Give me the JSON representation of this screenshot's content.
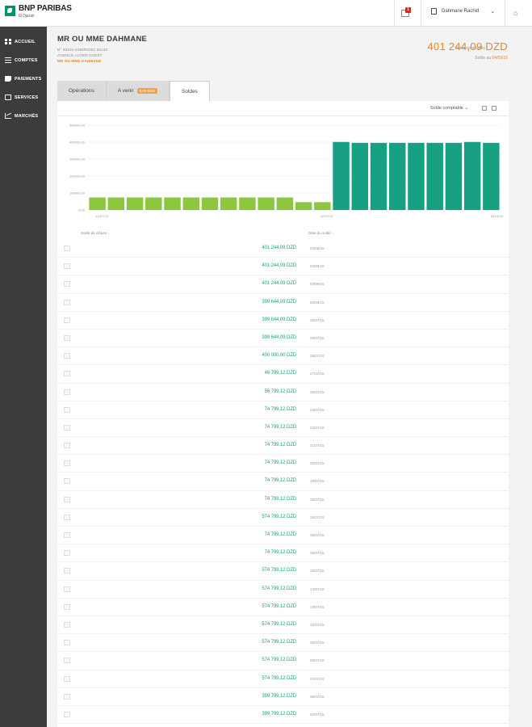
{
  "brand": {
    "name": "BNP PARIBAS",
    "sub": "El Djazaïr"
  },
  "topbar": {
    "notif_count": "1",
    "user_name": "Dahmane Rachid"
  },
  "nav": [
    {
      "label": "ACCUEIL",
      "icon": "grid-icon"
    },
    {
      "label": "COMPTES",
      "icon": "list-icon"
    },
    {
      "label": "PAIEMENTS",
      "icon": "payment-icon"
    },
    {
      "label": "SERVICES",
      "icon": "services-icon"
    },
    {
      "label": "MARCHÉS",
      "icon": "chart-icon"
    }
  ],
  "account": {
    "title": "MR OU MME DAHMANE",
    "line1": "N° 00101-0166R0002 20130",
    "line2": "AGENCE ALGER OUEST",
    "line3": "MR OU MME DAHMANE",
    "balance_label": "Solde comptable",
    "balance_value": "401 244,09 DZD",
    "balance2_label": "Solde au",
    "balance2_value": "04/09/15"
  },
  "tabs": [
    {
      "label": "Opérations",
      "badge": ""
    },
    {
      "label": "A venir",
      "badge": "0,00 DZD"
    },
    {
      "label": "Soldes",
      "badge": ""
    }
  ],
  "toolbar": {
    "select_label": "Solde comptable"
  },
  "chart_data": {
    "type": "bar",
    "yticks": [
      "500000,00",
      "400000,00",
      "300000,00",
      "200000,00",
      "100000,00",
      "0,00"
    ],
    "ylim": [
      0,
      500000
    ],
    "xticks": [
      "14/07/15",
      "20/07/15",
      "04/09/15"
    ],
    "values": [
      74000,
      74000,
      74000,
      74000,
      74000,
      74000,
      74000,
      74000,
      74000,
      74000,
      74000,
      46000,
      46000,
      401244,
      396000,
      396000,
      396000,
      396000,
      396000,
      396000,
      401244,
      396000
    ],
    "colors": {
      "low": "#8dc63f",
      "high": "#17a081"
    },
    "threshold": 200000
  },
  "table": {
    "col_amount": "Solde de clôture ↓",
    "col_date": "Date du solde ↓",
    "rows": [
      {
        "amount": "401 244,09 DZD",
        "date": "04/08/15"
      },
      {
        "amount": "401 244,09 DZD",
        "date": "04/08/15"
      },
      {
        "amount": "401 244,09 DZD",
        "date": "03/08/15"
      },
      {
        "amount": "399 644,09 DZD",
        "date": "02/08/15"
      },
      {
        "amount": "399 644,09 DZD",
        "date": "30/07/15"
      },
      {
        "amount": "399 644,09 DZD",
        "date": "29/07/15"
      },
      {
        "amount": "400 000,00 DZD",
        "date": "28/07/15"
      },
      {
        "amount": "46 799,12 DZD",
        "date": "27/07/15"
      },
      {
        "amount": "56 799,12 DZD",
        "date": "26/07/15"
      },
      {
        "amount": "74 799,12 DZD",
        "date": "23/07/15"
      },
      {
        "amount": "74 799,12 DZD",
        "date": "22/07/15"
      },
      {
        "amount": "74 799,12 DZD",
        "date": "21/07/15"
      },
      {
        "amount": "74 799,12 DZD",
        "date": "20/07/15"
      },
      {
        "amount": "74 799,12 DZD",
        "date": "19/07/15"
      },
      {
        "amount": "74 799,12 DZD",
        "date": "16/07/15"
      },
      {
        "amount": "574 799,12 DZD",
        "date": "15/07/15"
      },
      {
        "amount": "74 799,12 DZD",
        "date": "15/07/15"
      },
      {
        "amount": "74 799,12 DZD",
        "date": "16/07/15"
      },
      {
        "amount": "574 799,12 DZD",
        "date": "15/07/15"
      },
      {
        "amount": "574 799,12 DZD",
        "date": "14/07/15"
      },
      {
        "amount": "574 799,12 DZD",
        "date": "13/07/15"
      },
      {
        "amount": "574 799,12 DZD",
        "date": "12/07/15"
      },
      {
        "amount": "574 799,12 DZD",
        "date": "09/07/15"
      },
      {
        "amount": "574 799,12 DZD",
        "date": "08/07/15"
      },
      {
        "amount": "574 799,12 DZD",
        "date": "07/07/15"
      },
      {
        "amount": "399 799,12 DZD",
        "date": "06/07/15"
      },
      {
        "amount": "399 799,12 DZD",
        "date": "02/07/15"
      }
    ]
  }
}
